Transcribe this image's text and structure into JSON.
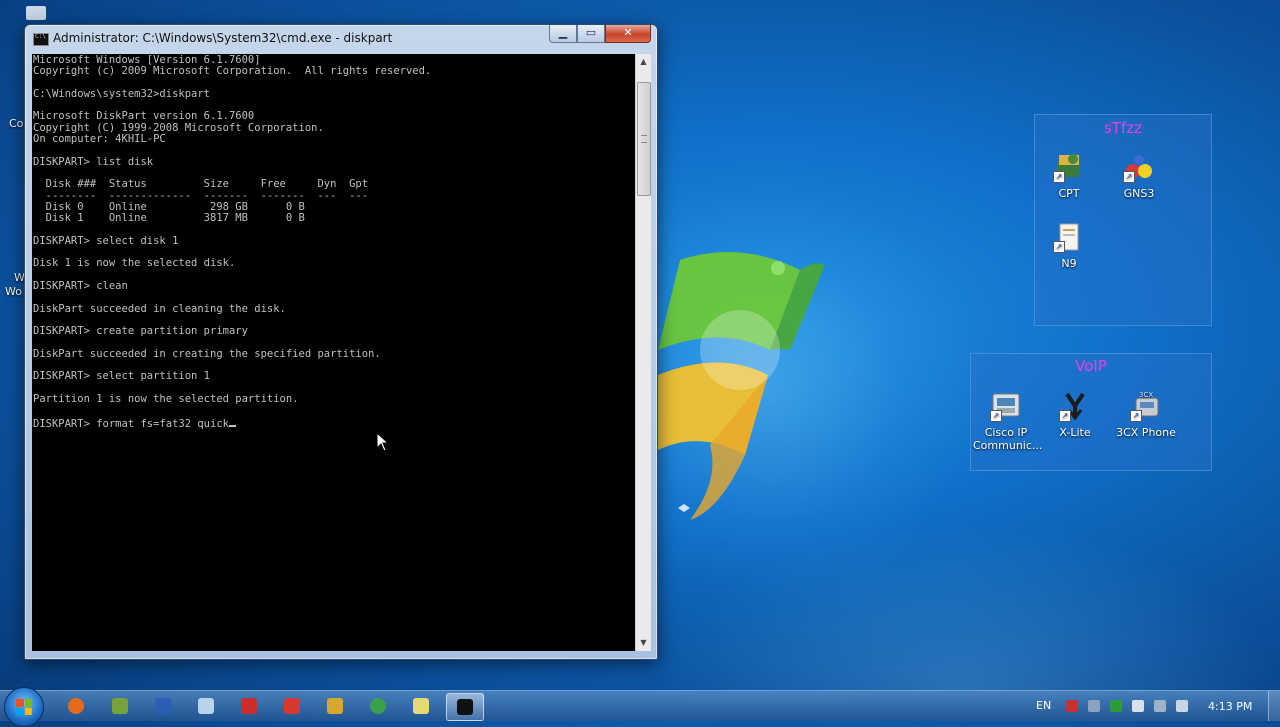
{
  "window": {
    "title": "Administrator: C:\\Windows\\System32\\cmd.exe - diskpart",
    "minimize": "▁",
    "maximize": "▭",
    "close": "✕"
  },
  "console": {
    "lines": [
      "Microsoft Windows [Version 6.1.7600]",
      "Copyright (c) 2009 Microsoft Corporation.  All rights reserved.",
      "",
      "C:\\Windows\\system32>diskpart",
      "",
      "Microsoft DiskPart version 6.1.7600",
      "Copyright (C) 1999-2008 Microsoft Corporation.",
      "On computer: 4KHIL-PC",
      "",
      "DISKPART> list disk",
      "",
      "  Disk ###  Status         Size     Free     Dyn  Gpt",
      "  --------  -------------  -------  -------  ---  ---",
      "  Disk 0    Online          298 GB      0 B",
      "  Disk 1    Online         3817 MB      0 B",
      "",
      "DISKPART> select disk 1",
      "",
      "Disk 1 is now the selected disk.",
      "",
      "DISKPART> clean",
      "",
      "DiskPart succeeded in cleaning the disk.",
      "",
      "DISKPART> create partition primary",
      "",
      "DiskPart succeeded in creating the specified partition.",
      "",
      "DISKPART> select partition 1",
      "",
      "Partition 1 is now the selected partition.",
      ""
    ],
    "current_input": "DISKPART> format fs=fat32 quick"
  },
  "desktop": {
    "edge_labels": [
      "Co",
      "W",
      "Wo"
    ],
    "groups": [
      {
        "title": "sTfzz",
        "icons": [
          {
            "label": "CPT",
            "icon": "packet-tracer-icon"
          },
          {
            "label": "GNS3",
            "icon": "gns3-icon"
          },
          {
            "label": "N9",
            "icon": "n9-document-icon"
          }
        ]
      },
      {
        "title": "VoIP",
        "icons": [
          {
            "label": "Cisco IP Communic...",
            "icon": "cisco-ip-communicator-icon"
          },
          {
            "label": "X-Lite",
            "icon": "x-lite-icon"
          },
          {
            "label": "3CX Phone",
            "icon": "3cx-phone-icon"
          }
        ]
      }
    ]
  },
  "taskbar": {
    "apps": [
      {
        "name": "firefox",
        "color": "#e66a1c"
      },
      {
        "name": "utility",
        "color": "#7aa23a"
      },
      {
        "name": "word",
        "color": "#2b5fb5"
      },
      {
        "name": "notepad",
        "color": "#b9d3ea"
      },
      {
        "name": "acrobat",
        "color": "#c9302c"
      },
      {
        "name": "tool-red",
        "color": "#d43a2f"
      },
      {
        "name": "archive",
        "color": "#d9a62e"
      },
      {
        "name": "chrome",
        "color": "#3aa14b"
      },
      {
        "name": "notes",
        "color": "#e7d97a"
      },
      {
        "name": "cmd",
        "color": "#111111"
      }
    ],
    "language": "EN",
    "clock": "4:13 PM"
  }
}
